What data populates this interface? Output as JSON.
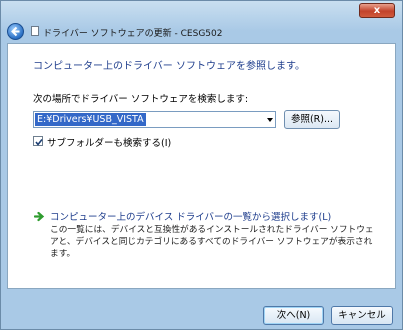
{
  "window": {
    "title": "ドライバー ソフトウェアの更新 - CESG502",
    "close_label": "x"
  },
  "content": {
    "heading": "コンピューター上のドライバー ソフトウェアを参照します。",
    "search_label": "次の場所でドライバー ソフトウェアを検索します:",
    "path_value": "E:¥Drivers¥USB_VISTA",
    "browse_label": "参照(R)...",
    "include_subfolders_label": "サブフォルダーも検索する(I)",
    "include_subfolders_checked": true,
    "pick_link": "コンピューター上のデバイス ドライバーの一覧から選択します(L)",
    "pick_description": "この一覧には、デバイスと互換性があるインストールされたドライバー ソフトウェアと、デバイスと同じカテゴリにあるすべてのドライバー ソフトウェアが表示されます。"
  },
  "footer": {
    "next_label": "次へ(N)",
    "cancel_label": "キャンセル"
  },
  "colors": {
    "accent_link": "#1e3d8c",
    "selection": "#3368c8",
    "green_arrow": "#2f9c2f"
  }
}
